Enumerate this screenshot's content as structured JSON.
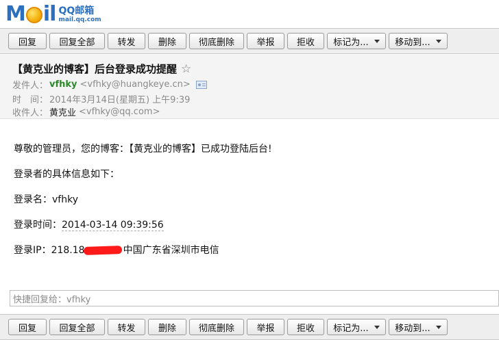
{
  "logo": {
    "brand_text_m": "M",
    "brand_text_il": "il",
    "cn": "QQ邮箱",
    "domain": "mail.qq.com"
  },
  "toolbar": {
    "reply": "回复",
    "reply_all": "回复全部",
    "forward": "转发",
    "delete": "删除",
    "delete_permanently": "彻底删除",
    "report": "举报",
    "reject": "拒收",
    "mark_as": "标记为...",
    "move_to": "移动到..."
  },
  "email": {
    "subject": "【黄克业的博客】后台登录成功提醒",
    "star_icon": "☆",
    "sender_label": "发件人：",
    "sender_name": "vfhky",
    "sender_addr": "<vfhky@huangkeye.cn>",
    "time_label": "时　间：",
    "time_value": "2014年3月14日(星期五) 上午9:39",
    "recipient_label": "收件人：",
    "recipient_name": "黄克业",
    "recipient_addr": "<vfhky@qq.com>"
  },
  "body": {
    "line1": "尊敬的管理员，您的博客：【黄克业的博客】已成功登陆后台!",
    "line2": "登录者的具体信息如下：",
    "line3_label": "登录名：",
    "line3_value": "vfhky",
    "line4_label": "登录时间：",
    "line4_value": "2014-03-14 09:39:56",
    "line5_label": "登录IP：",
    "line5_ip_prefix": "218.18",
    "line5_location": "中国广东省深圳市电信"
  },
  "quick_reply": {
    "placeholder": "快捷回复给：vfhky"
  },
  "colors": {
    "brand": "#2d6fbf",
    "sender_green": "#2a8a2a",
    "redaction": "#ff1a1a"
  }
}
